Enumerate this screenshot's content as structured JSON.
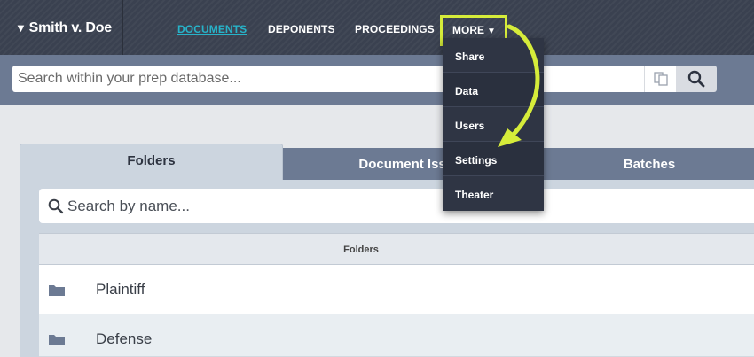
{
  "header": {
    "case_title": "Smith v. Doe",
    "nav": [
      {
        "label": "DOCUMENTS",
        "active": true
      },
      {
        "label": "DEPONENTS",
        "active": false
      },
      {
        "label": "PROCEEDINGS",
        "active": false
      }
    ],
    "more_label": "MORE"
  },
  "search": {
    "placeholder": "Search within your prep database...",
    "value": ""
  },
  "more_menu": {
    "items": [
      "Share",
      "Data",
      "Users",
      "Settings",
      "Theater"
    ]
  },
  "tabs": [
    {
      "label": "Folders",
      "active": true
    },
    {
      "label": "Document Issues",
      "active": false
    },
    {
      "label": "Batches",
      "active": false
    }
  ],
  "folder_search": {
    "placeholder": "Search by name..."
  },
  "folder_list": {
    "header": "Folders",
    "rows": [
      {
        "name": "Plaintiff",
        "icon": "folder-icon"
      },
      {
        "name": "Defense",
        "icon": "folder-icon"
      }
    ]
  },
  "colors": {
    "topbar": "#3a4150",
    "active_nav": "#27b3c9",
    "highlight": "#d6ec3a",
    "band": "#6c7a93",
    "menu": "#2f3544"
  }
}
